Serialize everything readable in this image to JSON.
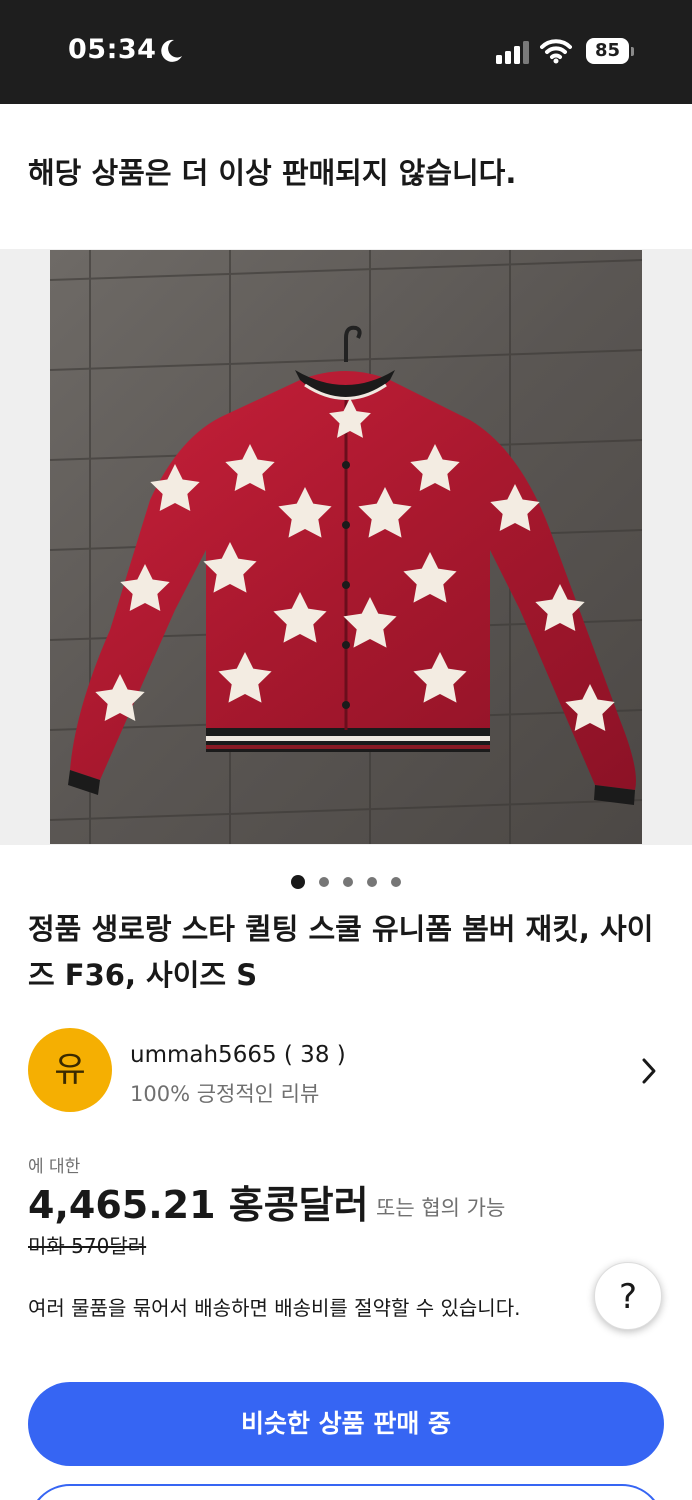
{
  "status_bar": {
    "time": "05:34",
    "battery": "85"
  },
  "notice": "해당 상품은 더 이상 판매되지 않습니다.",
  "gallery": {
    "image_count": 5,
    "active_index": 0
  },
  "title": "정품 생로랑 스타 퀼팅 스쿨 유니폼 봄버 재킷, 사이즈 F36, 사이즈 S",
  "seller": {
    "avatar_letter": "유",
    "name": "ummah5665 ( 38 )",
    "review": "100% 긍정적인 리뷰"
  },
  "price": {
    "label": "에 대한",
    "amount": "4,465.21 홍콩달러",
    "alt": "또는 협의 가능",
    "original": "미화 570달러"
  },
  "bundle_text": "여러 물품을 묶어서 배송하면 배송비를 절약할 수 있습니다.",
  "help_label": "?",
  "buttons": {
    "primary": "비슷한 상품 판매 중"
  },
  "colors": {
    "accent": "#3665f3",
    "avatar": "#f5af02",
    "status_bar": "#1e1e1e"
  }
}
